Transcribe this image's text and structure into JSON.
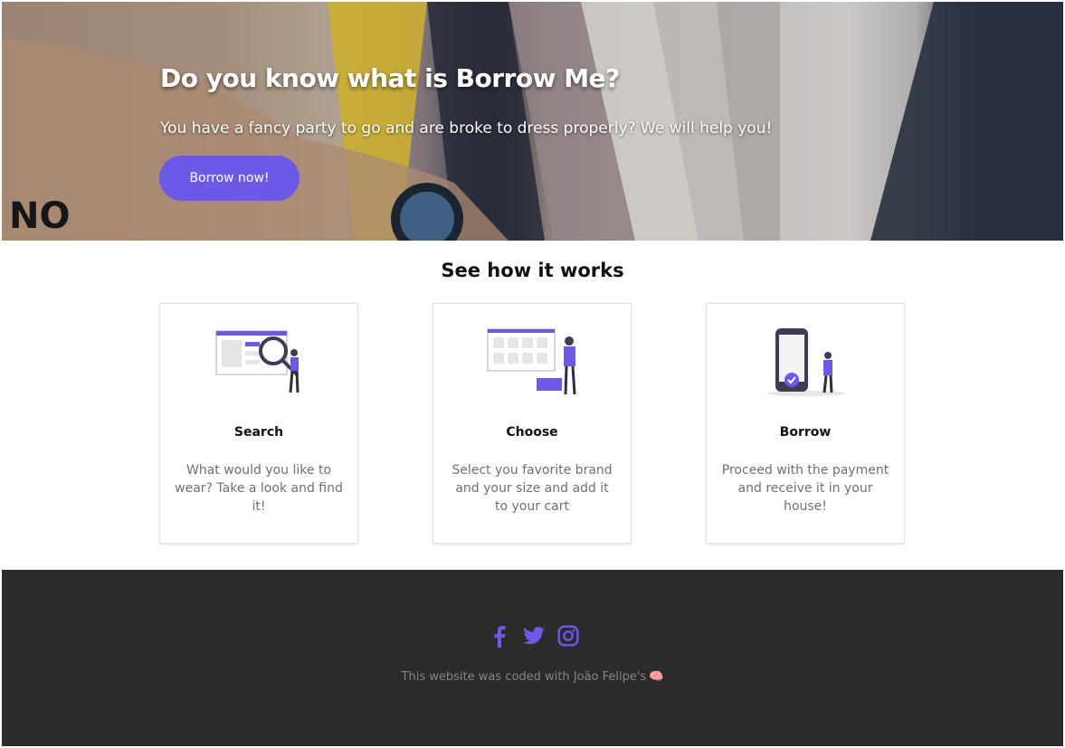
{
  "hero": {
    "title": "Do you know what is Borrow Me?",
    "subtitle": "You have a fancy party to go and are broke to dress properly? We will help you!",
    "cta_label": "Borrow now!",
    "tag_text": "NO"
  },
  "how_it_works": {
    "title": "See how it works",
    "steps": [
      {
        "title": "Search",
        "description": "What would you like to wear? Take a look and find it!",
        "icon": "search-illustration"
      },
      {
        "title": "Choose",
        "description": "Select you favorite brand and your size and add it to your cart",
        "icon": "choose-illustration"
      },
      {
        "title": "Borrow",
        "description": "Proceed with the payment and receive it in your house!",
        "icon": "borrow-illustration"
      }
    ]
  },
  "footer": {
    "social": [
      "facebook-icon",
      "twitter-icon",
      "instagram-icon"
    ],
    "credit": "This website was coded with João Felipe's",
    "credit_emoji": "🧠"
  },
  "colors": {
    "accent": "#6a5ae6",
    "footer_bg": "#2b2b2b",
    "muted_text": "#707070"
  }
}
